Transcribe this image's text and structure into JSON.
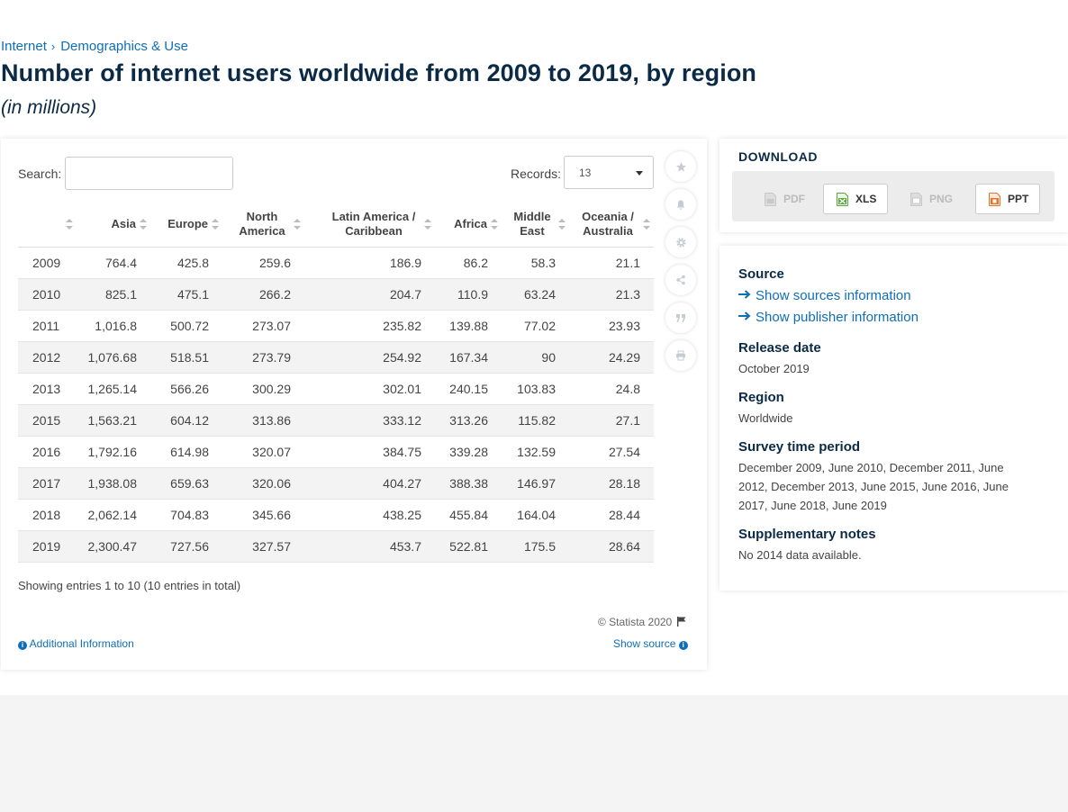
{
  "breadcrumb": {
    "items": [
      "Internet",
      "Demographics & Use"
    ],
    "sep": "›"
  },
  "page": {
    "title": "Number of internet users worldwide from 2009 to 2019, by region",
    "subtitle": "(in millions)"
  },
  "controls": {
    "search_label": "Search:",
    "search_value": "",
    "records_label": "Records:",
    "records_value": "13"
  },
  "table": {
    "headers": [
      "",
      "Asia",
      "Europe",
      "North America",
      "Latin America / Caribbean",
      "Africa",
      "Middle East",
      "Oceania / Australia"
    ],
    "rows": [
      [
        "2009",
        "764.4",
        "425.8",
        "259.6",
        "186.9",
        "86.2",
        "58.3",
        "21.1"
      ],
      [
        "2010",
        "825.1",
        "475.1",
        "266.2",
        "204.7",
        "110.9",
        "63.24",
        "21.3"
      ],
      [
        "2011",
        "1,016.8",
        "500.72",
        "273.07",
        "235.82",
        "139.88",
        "77.02",
        "23.93"
      ],
      [
        "2012",
        "1,076.68",
        "518.51",
        "273.79",
        "254.92",
        "167.34",
        "90",
        "24.29"
      ],
      [
        "2013",
        "1,265.14",
        "566.26",
        "300.29",
        "302.01",
        "240.15",
        "103.83",
        "24.8"
      ],
      [
        "2015",
        "1,563.21",
        "604.12",
        "313.86",
        "333.12",
        "313.26",
        "115.82",
        "27.1"
      ],
      [
        "2016",
        "1,792.16",
        "614.98",
        "320.07",
        "384.75",
        "339.28",
        "132.59",
        "27.54"
      ],
      [
        "2017",
        "1,938.08",
        "659.63",
        "320.06",
        "404.27",
        "388.38",
        "146.97",
        "28.18"
      ],
      [
        "2018",
        "2,062.14",
        "704.83",
        "345.66",
        "438.25",
        "455.84",
        "164.04",
        "28.44"
      ],
      [
        "2019",
        "2,300.47",
        "727.56",
        "327.57",
        "453.7",
        "522.81",
        "175.5",
        "28.64"
      ]
    ]
  },
  "footer": {
    "entries_info": "Showing entries 1 to 10 (10 entries in total)",
    "copyright": "© Statista 2020",
    "additional_info": "Additional Information",
    "show_source": "Show source"
  },
  "toolbar": {
    "icons": [
      "star-icon",
      "bell-icon",
      "gear-icon",
      "share-icon",
      "quote-icon",
      "print-icon"
    ]
  },
  "download": {
    "heading": "DOWNLOAD",
    "buttons": [
      {
        "label": "PDF",
        "enabled": false
      },
      {
        "label": "XLS",
        "enabled": true
      },
      {
        "label": "PNG",
        "enabled": false
      },
      {
        "label": "PPT",
        "enabled": true
      }
    ]
  },
  "meta": {
    "source_heading": "Source",
    "show_sources": "Show sources information",
    "show_publisher": "Show publisher information",
    "release_heading": "Release date",
    "release_value": "October 2019",
    "region_heading": "Region",
    "region_value": "Worldwide",
    "survey_heading": "Survey time period",
    "survey_value": "December 2009, June 2010, December 2011, June 2012, December 2013, June 2015, June 2016, June 2017, June 2018, June 2019",
    "notes_heading": "Supplementary notes",
    "notes_value": "No 2014 data available."
  },
  "colors": {
    "link": "#0f6fb5",
    "title": "#0b2a45",
    "xls": "#5aa83c",
    "ppt": "#e8732b"
  }
}
